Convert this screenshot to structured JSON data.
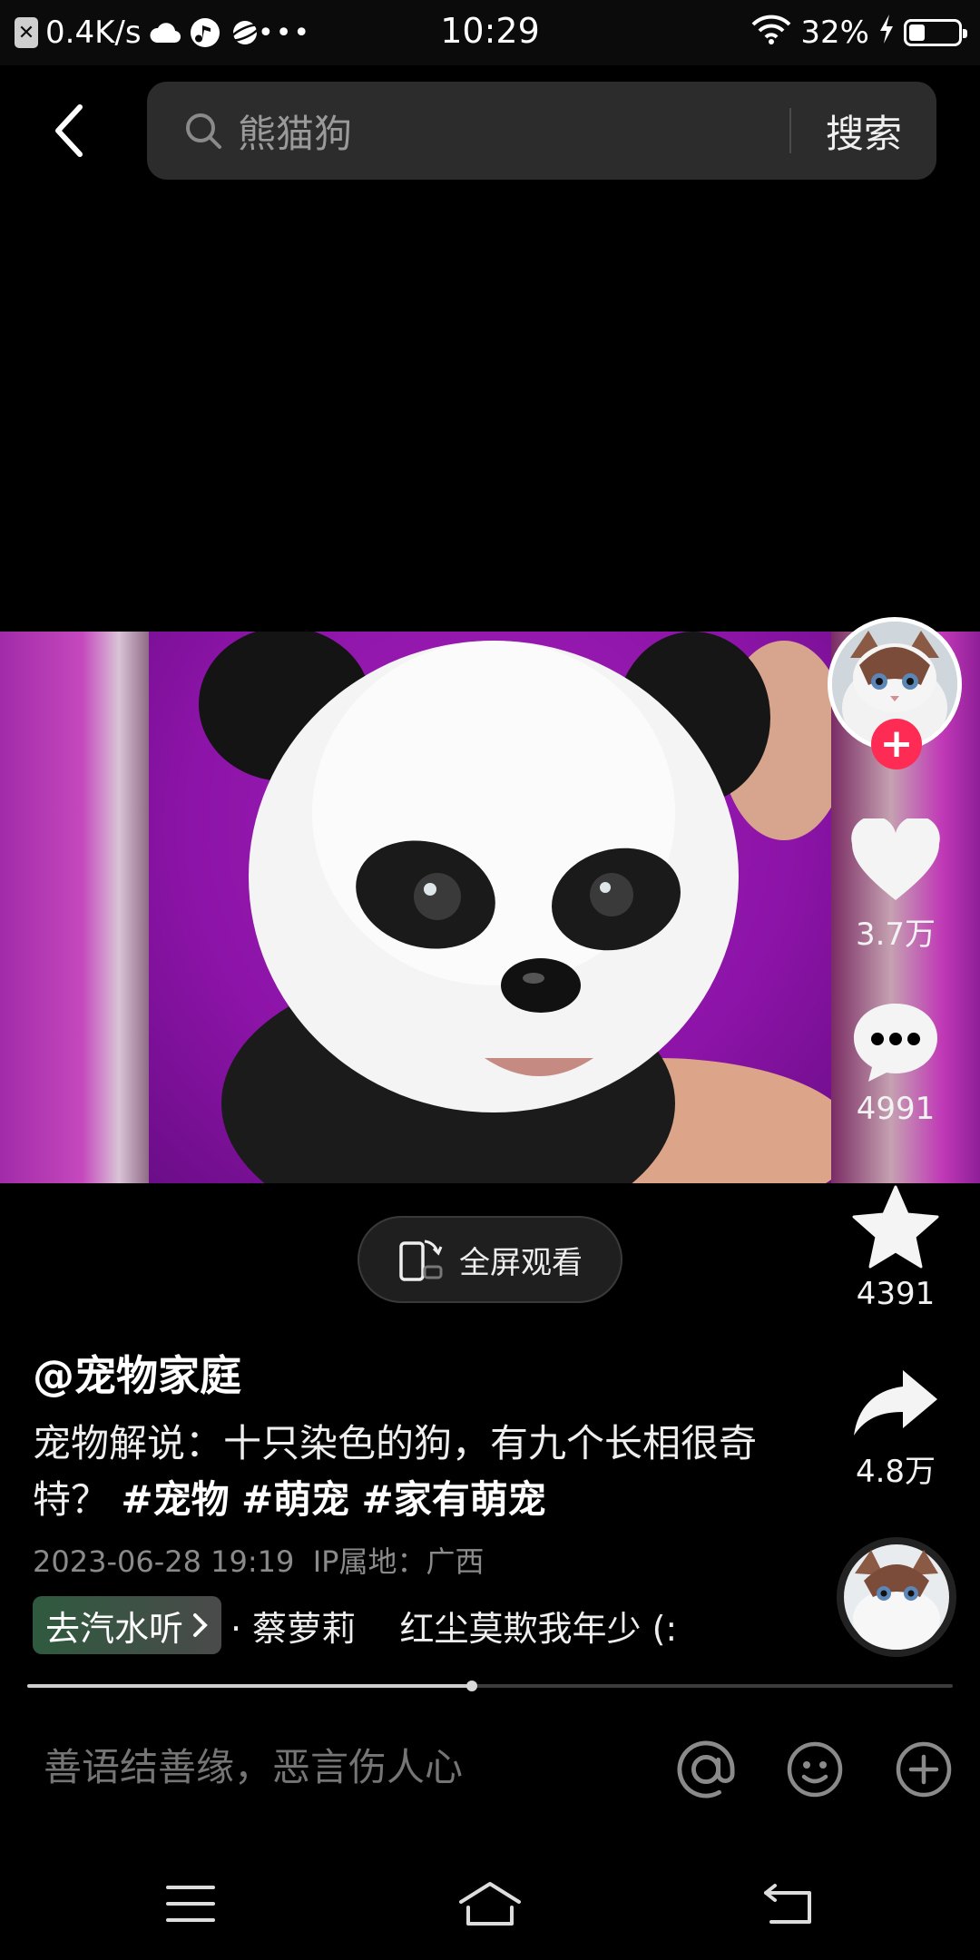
{
  "status_bar": {
    "speed": "0.4K/s",
    "time": "10:29",
    "battery": "32%",
    "battery_level": 0.32,
    "icons": [
      "close-badge-icon",
      "weather-icon",
      "music-app-icon",
      "planet-icon",
      "more-dots-icon",
      "wifi-icon",
      "charging-icon",
      "battery-icon"
    ]
  },
  "search": {
    "value": "熊猫狗",
    "button": "搜索"
  },
  "actions": {
    "likes": "3.7万",
    "comments": "4991",
    "favorites": "4391",
    "shares": "4.8万"
  },
  "fullscreen": {
    "label": "全屏观看"
  },
  "post": {
    "author": "@宠物家庭",
    "caption_text": "宠物解说：十只染色的狗，有九个长相很奇特？",
    "tags": [
      "#宠物",
      "#萌宠",
      "#家有萌宠"
    ],
    "meta": "2023-06-28 19:19  IP属地：广西"
  },
  "music": {
    "listen_button": "去汽水听",
    "text": "· 蔡萝莉    红尘莫欺我年少 (:"
  },
  "playback": {
    "progress": 0.48
  },
  "comment_bar": {
    "placeholder": "善语结善缘，恶言伤人心"
  },
  "colors": {
    "accent": "#fe2c55",
    "search_bg": "#2c2c2c",
    "video_bg": "#8d14a8"
  }
}
